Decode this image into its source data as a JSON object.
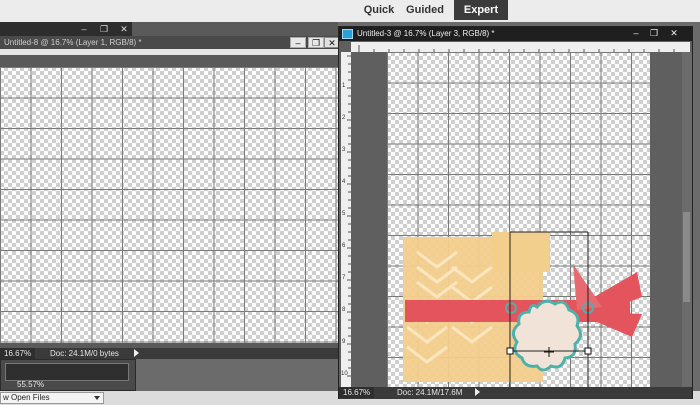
{
  "modes": {
    "quick": "Quick",
    "guided": "Guided",
    "expert": "Expert"
  },
  "window_controls": {
    "minimize": "–",
    "restore": "❐",
    "close": "✕"
  },
  "left_document": {
    "title": "Untitled-8 @ 16.7% (Layer 1, RGB/8) *",
    "zoom": "16.67%",
    "doc_size": "Doc: 24.1M/0 bytes"
  },
  "photo_bin": {
    "thumb_zoom": "55.57%",
    "dropdown_value": "w Open Files"
  },
  "right_document": {
    "title": "Untitled-3 @ 16.7% (Layer 3, RGB/8) *",
    "zoom": "16.67%",
    "doc_size": "Doc: 24.1M/17.6M",
    "ruler_numbers": [
      "1",
      "2",
      "3",
      "4",
      "5",
      "6",
      "7",
      "8",
      "9",
      "10"
    ]
  },
  "colors": {
    "accent_blue": "#2aa1d8",
    "ribbon_red": "#e4545c",
    "paper_yellow": "#f3cf8d",
    "tag_teal": "#4fb0aa"
  }
}
